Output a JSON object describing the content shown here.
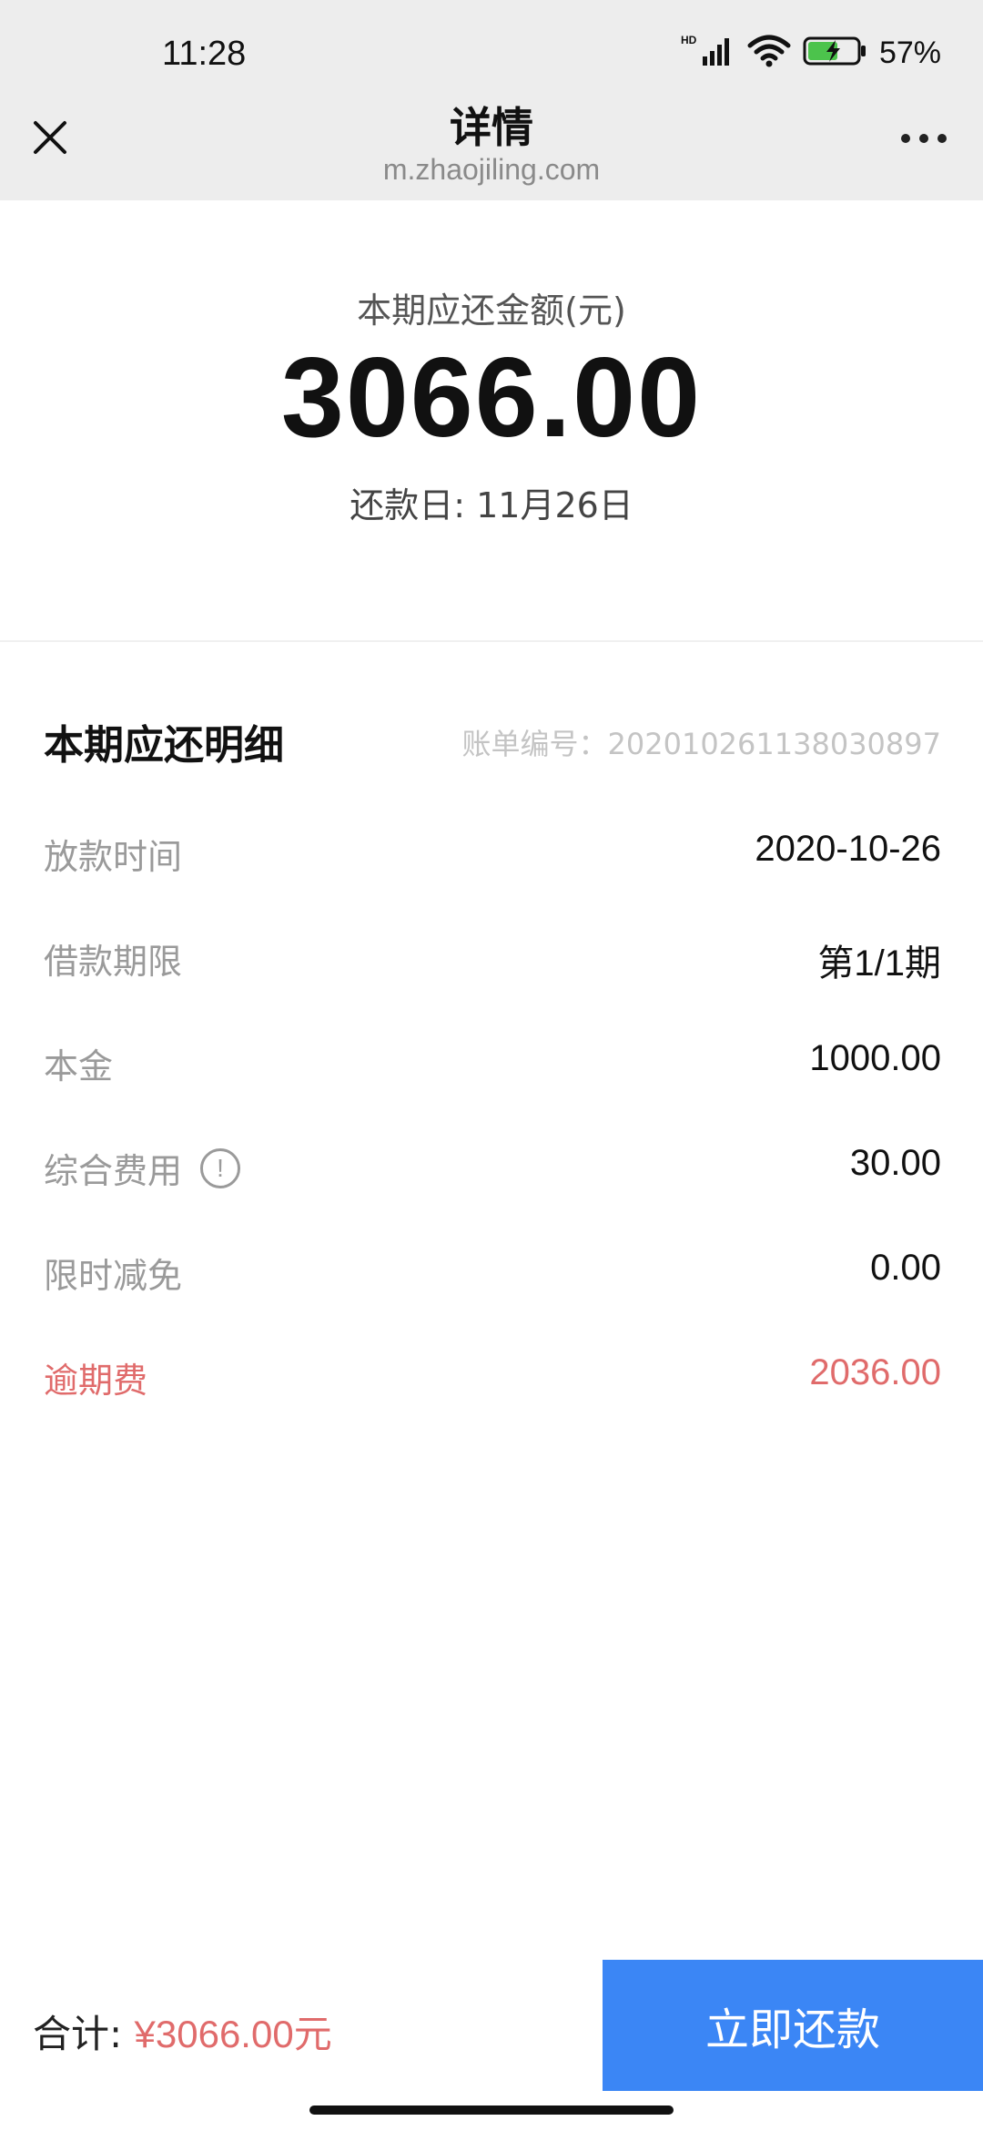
{
  "status_bar": {
    "time": "11:28",
    "battery_percent": "57%",
    "network_label": "HD"
  },
  "header": {
    "title": "详情",
    "url": "m.zhaojiling.com",
    "icons": [
      "close-icon",
      "more-icon"
    ]
  },
  "summary": {
    "amount_label": "本期应还金额(元)",
    "amount": "3066.00",
    "due_date": "还款日: 11月26日"
  },
  "detail": {
    "title": "本期应还明细",
    "bill_no": "账单编号：202010261138030897",
    "rows": [
      {
        "label": "放款时间",
        "value": "2020-10-26"
      },
      {
        "label": "借款期限",
        "value": "第1/1期"
      },
      {
        "label": "本金",
        "value": "1000.00"
      },
      {
        "label": "综合费用",
        "value": "30.00",
        "info_icon": "!"
      },
      {
        "label": "限时减免",
        "value": "0.00"
      },
      {
        "label": "逾期费",
        "value": "2036.00"
      }
    ],
    "overdue_color": "#e06b6b"
  },
  "footer": {
    "total_label": "合计:",
    "total_amount": "¥3066.00元",
    "pay_button": "立即还款",
    "accent_color": "#3b86f5"
  }
}
